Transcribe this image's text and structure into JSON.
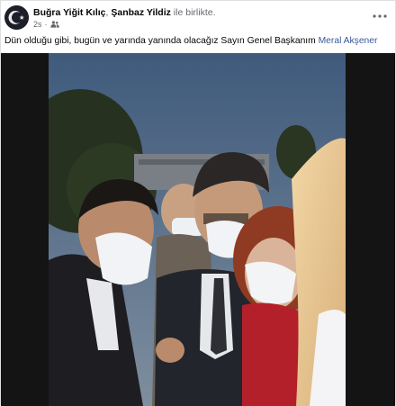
{
  "post": {
    "author_primary": "Buğra Yiğit Kılıç",
    "separator": ", ",
    "author_secondary": "Şanbaz Yildiz",
    "with_text": " ile birlikte.",
    "timestamp": "2s",
    "dot": "·",
    "audience_icon": "friends-icon",
    "more_label": "•••",
    "caption_text": "Dün olduğu gibi, bugün ve yarında yanında olacağız Sayın Genel Başkanım ",
    "caption_mention": "Meral Akşener",
    "avatar_icon": "crescent-star-icon"
  }
}
